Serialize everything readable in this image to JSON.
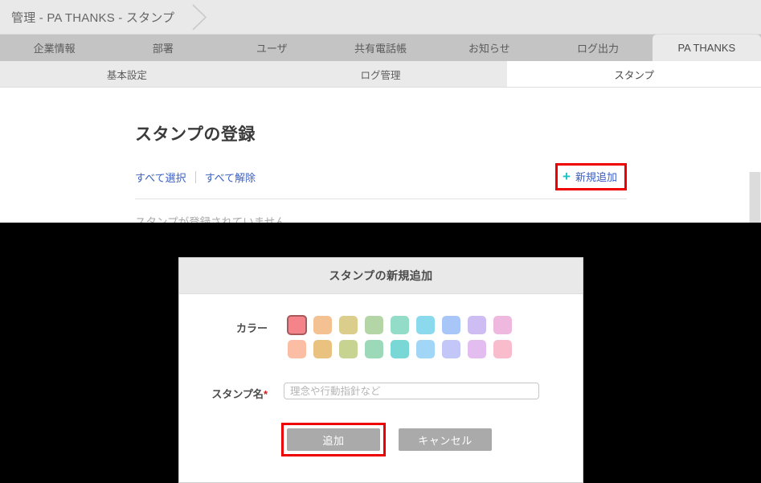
{
  "breadcrumb": {
    "text": "管理 - PA THANKS - スタンプ",
    "chevron_icon": "chevron-right-icon"
  },
  "primary_tabs": [
    {
      "label": "企業情報",
      "active": false
    },
    {
      "label": "部署",
      "active": false
    },
    {
      "label": "ユーザ",
      "active": false
    },
    {
      "label": "共有電話帳",
      "active": false
    },
    {
      "label": "お知らせ",
      "active": false
    },
    {
      "label": "ログ出力",
      "active": false
    },
    {
      "label": "PA THANKS",
      "active": true
    }
  ],
  "secondary_tabs": [
    {
      "label": "基本設定",
      "active": false
    },
    {
      "label": "ログ管理",
      "active": false
    },
    {
      "label": "スタンプ",
      "active": true
    }
  ],
  "content": {
    "page_title": "スタンプの登録",
    "select_all_label": "すべて選択",
    "deselect_all_label": "すべて解除",
    "add_new_label": "新規追加",
    "plus_icon": "plus-icon",
    "empty_message": "スタンプが登録されていません。"
  },
  "modal": {
    "title": "スタンプの新規追加",
    "color_label": "カラー",
    "name_label": "スタンプ名",
    "required_mark": "*",
    "name_placeholder": "理念や行動指針など",
    "name_value": "",
    "submit_label": "追加",
    "cancel_label": "キャンセル",
    "colors_row1": [
      "#f5838a",
      "#f4c193",
      "#dbcd8b",
      "#b4d6a6",
      "#93ddc8",
      "#8ad9ec",
      "#a9c6f8",
      "#cebdf3",
      "#efb8de"
    ],
    "colors_row2": [
      "#fbbda4",
      "#e9c280",
      "#c6d391",
      "#9bd9b8",
      "#79d7d6",
      "#a2d6f6",
      "#c3c7f8",
      "#e3bdef",
      "#f9bccd"
    ],
    "selected_color_index": 0,
    "selected_color": "#f5838a",
    "selected_border_color": "#a85a5a"
  },
  "annotations": {
    "highlight_color": "#ee0000",
    "highlighted_items": [
      "新規追加",
      "追加"
    ]
  }
}
